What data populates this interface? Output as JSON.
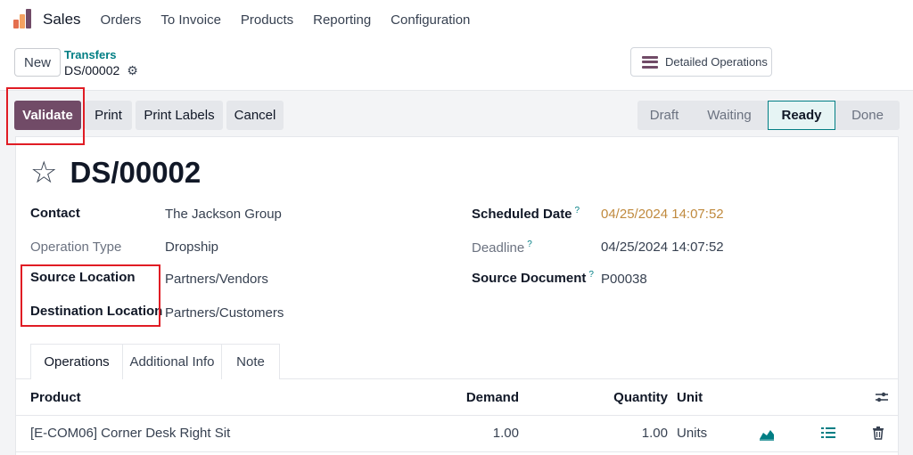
{
  "navbar": {
    "app_name": "Sales",
    "menu": [
      "Orders",
      "To Invoice",
      "Products",
      "Reporting",
      "Configuration"
    ]
  },
  "control_panel": {
    "new_label": "New",
    "breadcrumb_parent": "Transfers",
    "breadcrumb_current": "DS/00002",
    "detailed_operations_label": "Detailed Operations"
  },
  "actions": {
    "validate": "Validate",
    "print": "Print",
    "print_labels": "Print Labels",
    "cancel": "Cancel"
  },
  "statusbar": {
    "stages": [
      "Draft",
      "Waiting",
      "Ready",
      "Done"
    ],
    "current": "Ready"
  },
  "record": {
    "name": "DS/00002",
    "fields_left": [
      {
        "label": "Contact",
        "value": "The Jackson Group"
      },
      {
        "label": "Operation Type",
        "value": "Dropship"
      },
      {
        "label": "Source Location",
        "value": "Partners/Vendors"
      },
      {
        "label": "Destination Location",
        "value": "Partners/Customers"
      }
    ],
    "fields_right": [
      {
        "label": "Scheduled Date",
        "tooltip": "?",
        "value": "04/25/2024 14:07:52"
      },
      {
        "label": "Deadline",
        "tooltip": "?",
        "value": "04/25/2024 14:07:52"
      },
      {
        "label": "Source Document",
        "tooltip": "?",
        "value": "P00038"
      }
    ]
  },
  "tabs": [
    "Operations",
    "Additional Info",
    "Note"
  ],
  "table": {
    "headers": {
      "product": "Product",
      "demand": "Demand",
      "quantity": "Quantity",
      "unit": "Unit"
    },
    "rows": [
      {
        "product": "[E-COM06] Corner Desk Right Sit",
        "demand": "1.00",
        "quantity": "1.00",
        "unit": "Units"
      }
    ]
  },
  "colors": {
    "primary": "#714b67",
    "accent": "#017e84",
    "highlight": "#e01c24",
    "warning_date": "#c08a3e"
  },
  "icons": [
    "gear-icon",
    "star-icon",
    "hamburger-icon",
    "forecast-chart-icon",
    "details-list-icon",
    "trash-icon",
    "column-settings-icon"
  ]
}
